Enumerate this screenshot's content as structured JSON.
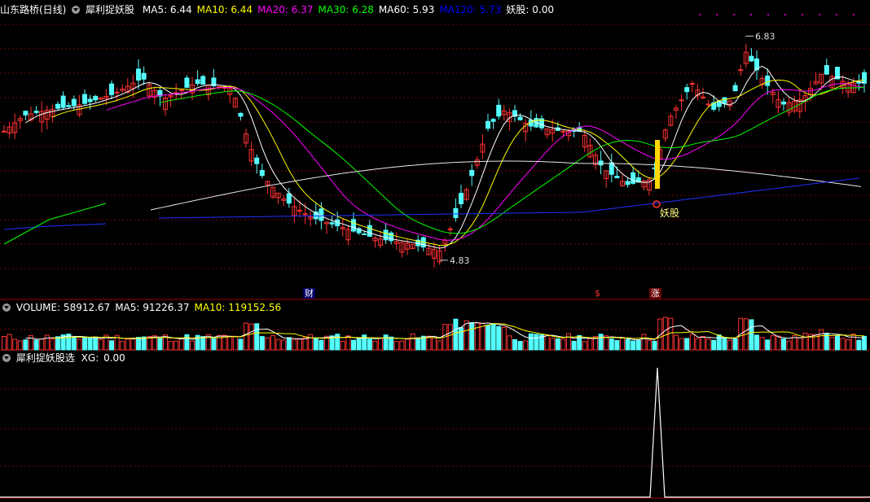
{
  "main_header": {
    "stock": "山东路桥(日线)",
    "indicator": "犀利捉妖股",
    "items": [
      {
        "label": "MA5:",
        "value": "6.44",
        "color": "#ffffff"
      },
      {
        "label": "MA10:",
        "value": "6.44",
        "color": "#ffff00"
      },
      {
        "label": "MA20:",
        "value": "6.37",
        "color": "#ff00ff"
      },
      {
        "label": "MA30:",
        "value": "6.28",
        "color": "#00ff00"
      },
      {
        "label": "MA60:",
        "value": "5.93",
        "color": "#ffffff"
      },
      {
        "label": "MA120:",
        "value": "5.73",
        "color": "#0000ff"
      },
      {
        "label": "妖股:",
        "value": "0.00",
        "color": "#ffffff"
      }
    ]
  },
  "price_annotations": {
    "high": "6.83",
    "low": "4.83",
    "signal": "妖股"
  },
  "markers": {
    "cai": "财",
    "dollar": "$",
    "zhang": "涨"
  },
  "volume_header": {
    "items": [
      {
        "label": "VOLUME:",
        "value": "58912.67",
        "color": "#ffffff"
      },
      {
        "label": "MA5:",
        "value": "91226.37",
        "color": "#ffffff"
      },
      {
        "label": "MA10:",
        "value": "119152.56",
        "color": "#ffff00"
      }
    ]
  },
  "sub_header": {
    "indicator": "犀利捉妖股选",
    "label": "XG:",
    "value": "0.00"
  },
  "colors": {
    "up": "#ff3232",
    "down": "#54ffff",
    "grid": "#7a0000",
    "signal_bar": "#ffd800"
  },
  "chart_data": {
    "type": "candlestick",
    "price_range": [
      4.6,
      7.0
    ],
    "high_label_value": 6.83,
    "low_label_value": 4.83,
    "xg_signal_value": 1.0
  }
}
